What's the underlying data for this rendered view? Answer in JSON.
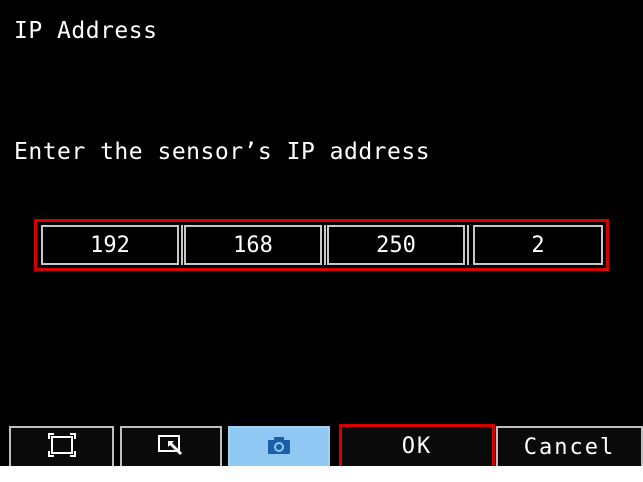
{
  "screen": {
    "title": "IP Address",
    "prompt": "Enter the sensor’s IP address"
  },
  "ip_address": {
    "octets": [
      "192",
      "168",
      "250",
      "2"
    ]
  },
  "toolbar": {
    "fit_icon": "fit-screen-icon",
    "zoom_icon": "zoom-icon",
    "camera_icon": "camera-icon",
    "ok_label": "OK",
    "cancel_label": "Cancel"
  },
  "colors": {
    "background": "#000000",
    "highlight_border": "#d40000",
    "camera_active": "#8fc8f2",
    "camera_icon": "#1a5fa8"
  }
}
